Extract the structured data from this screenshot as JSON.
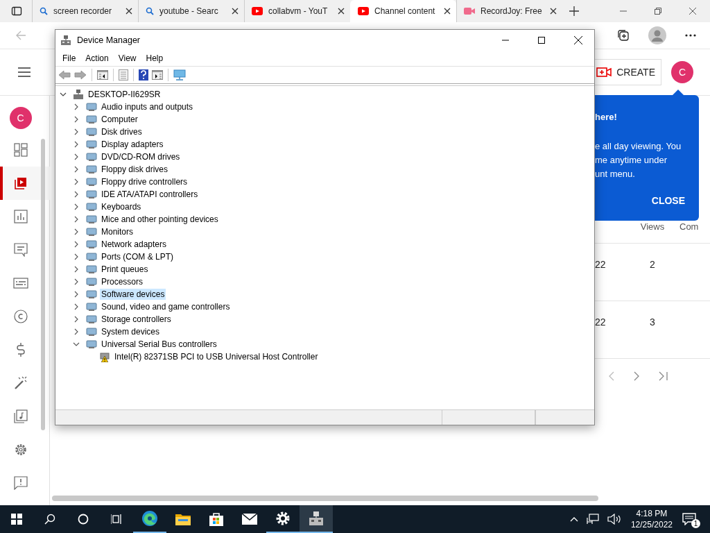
{
  "browser": {
    "tabs": [
      {
        "title": "screen recorder",
        "kind": "search",
        "selected": false
      },
      {
        "title": "youtube - Searc",
        "kind": "search",
        "selected": false
      },
      {
        "title": "collabvm - YouT",
        "kind": "video",
        "selected": false
      },
      {
        "title": "Channel content",
        "kind": "video",
        "selected": true
      },
      {
        "title": "RecordJoy: Free",
        "kind": "camera",
        "selected": false
      }
    ]
  },
  "studio": {
    "header_avatar": "C",
    "rail_avatar": "C",
    "create": "CREATE",
    "rail": [
      {
        "kind": "dashboard",
        "selected": false
      },
      {
        "kind": "content",
        "selected": true
      },
      {
        "kind": "analytics",
        "selected": false
      },
      {
        "kind": "comments",
        "selected": false
      },
      {
        "kind": "subtitles",
        "selected": false
      },
      {
        "kind": "copyright",
        "selected": false
      },
      {
        "kind": "earn",
        "selected": false
      },
      {
        "kind": "customize",
        "selected": false
      },
      {
        "kind": "audio",
        "selected": false
      },
      {
        "kind": "settings",
        "selected": false
      },
      {
        "kind": "feedback",
        "selected": false
      }
    ],
    "popup": {
      "title": "here!",
      "lines": [
        "e all day viewing. You",
        "me anytime under",
        "unt menu."
      ],
      "button": "CLOSE"
    },
    "table": {
      "columns": [
        "Views",
        "Com"
      ],
      "rows": [
        {
          "date": "22",
          "views": "2"
        },
        {
          "date": "22",
          "views": "3"
        }
      ]
    }
  },
  "device_manager": {
    "title": "Device Manager",
    "menu": [
      "File",
      "Action",
      "View",
      "Help"
    ],
    "tree": {
      "label": "DESKTOP-II629SR",
      "expanded": true,
      "children": [
        {
          "label": "Audio inputs and outputs",
          "expanded": false,
          "selected": false
        },
        {
          "label": "Computer",
          "expanded": false,
          "selected": false
        },
        {
          "label": "Disk drives",
          "expanded": false,
          "selected": false
        },
        {
          "label": "Display adapters",
          "expanded": false,
          "selected": false
        },
        {
          "label": "DVD/CD-ROM drives",
          "expanded": false,
          "selected": false
        },
        {
          "label": "Floppy disk drives",
          "expanded": false,
          "selected": false
        },
        {
          "label": "Floppy drive controllers",
          "expanded": false,
          "selected": false
        },
        {
          "label": "IDE ATA/ATAPI controllers",
          "expanded": false,
          "selected": false
        },
        {
          "label": "Keyboards",
          "expanded": false,
          "selected": false
        },
        {
          "label": "Mice and other pointing devices",
          "expanded": false,
          "selected": false
        },
        {
          "label": "Monitors",
          "expanded": false,
          "selected": false
        },
        {
          "label": "Network adapters",
          "expanded": false,
          "selected": false
        },
        {
          "label": "Ports (COM & LPT)",
          "expanded": false,
          "selected": false
        },
        {
          "label": "Print queues",
          "expanded": false,
          "selected": false
        },
        {
          "label": "Processors",
          "expanded": false,
          "selected": false
        },
        {
          "label": "Software devices",
          "expanded": false,
          "selected": true
        },
        {
          "label": "Sound, video and game controllers",
          "expanded": false,
          "selected": false
        },
        {
          "label": "Storage controllers",
          "expanded": false,
          "selected": false
        },
        {
          "label": "System devices",
          "expanded": false,
          "selected": false
        },
        {
          "label": "Universal Serial Bus controllers",
          "expanded": true,
          "selected": false,
          "children": [
            {
              "label": "Intel(R) 82371SB PCI to USB Universal Host Controller",
              "warning": true
            }
          ]
        }
      ]
    }
  },
  "taskbar": {
    "apps": [
      {
        "kind": "edge",
        "running": true,
        "selected": false
      },
      {
        "kind": "folder",
        "running": false,
        "selected": false
      },
      {
        "kind": "store",
        "running": false,
        "selected": false
      },
      {
        "kind": "mail",
        "running": false,
        "selected": false
      },
      {
        "kind": "settings",
        "running": true,
        "selected": false
      },
      {
        "kind": "devmgr",
        "running": true,
        "selected": true
      }
    ],
    "time": "4:18 PM",
    "date": "12/25/2022",
    "notifications": "1"
  }
}
